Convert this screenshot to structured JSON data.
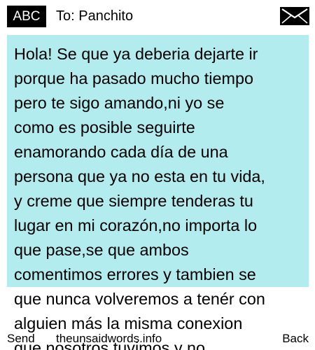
{
  "header": {
    "mode_label": "ABC",
    "recipient": "To: Panchito",
    "envelope_icon": "envelope-icon"
  },
  "message": {
    "lines": [
      "Hola! Se que ya deberia dejarte ir",
      "porque ha pasado mucho tiempo",
      "pero te sigo amando,ni yo se",
      "como es posible seguirte",
      "enamorando cada día de una",
      "persona que ya no esta en tu vida,",
      "y creme que siempre tenderas tu",
      "lugar en mi corazón,no importa lo",
      "que pase,se que ambos",
      "comentimos errores y tambien se",
      "que nunca volveremos a tenér con",
      "alguien más la misma conexion",
      "que nosotros tuvimos y no"
    ],
    "highlight_color": "#b2ecee"
  },
  "softkeys": {
    "left": "Send",
    "center": "theunsaidwords.info",
    "right": "Back"
  }
}
